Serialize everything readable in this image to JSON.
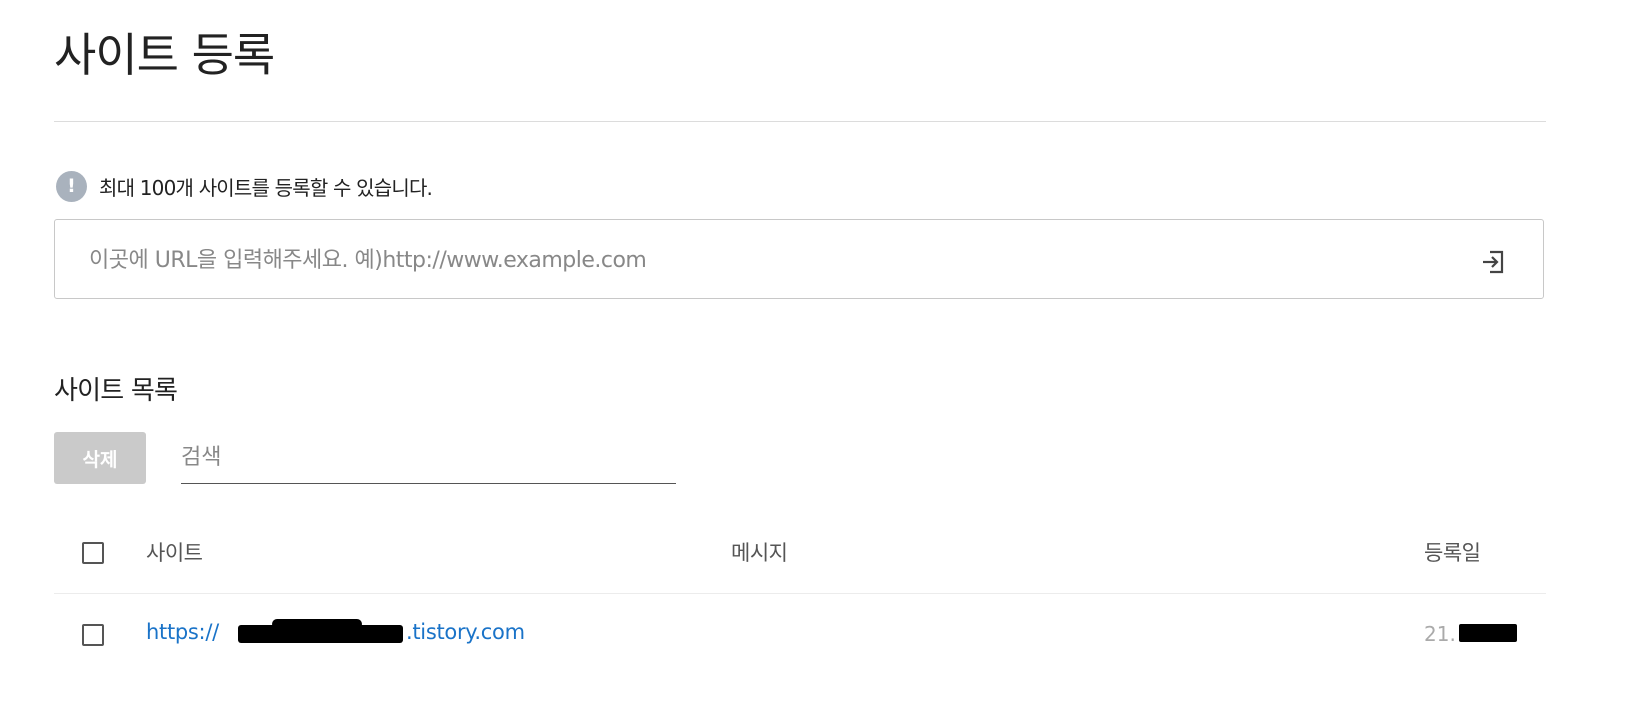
{
  "header": {
    "title": "사이트 등록"
  },
  "notice": {
    "icon": "exclamation-icon",
    "text": "최대 100개 사이트를 등록할 수 있습니다."
  },
  "url_form": {
    "placeholder": "이곳에 URL을 입력해주세요. 예)http://www.example.com",
    "value": "",
    "submit_icon": "enter-icon"
  },
  "site_list": {
    "title": "사이트 목록",
    "delete_label": "삭제",
    "search_placeholder": "검색",
    "columns": {
      "site": "사이트",
      "message": "메시지",
      "date": "등록일"
    },
    "rows": [
      {
        "site_prefix": "https://",
        "site_suffix": ".tistory.com",
        "message": "",
        "date_prefix": "21.",
        "checked": false
      }
    ]
  },
  "colors": {
    "link": "#1a73c8",
    "delete_button_bg": "#cacaca",
    "notice_icon_bg": "#a9b2bd"
  }
}
